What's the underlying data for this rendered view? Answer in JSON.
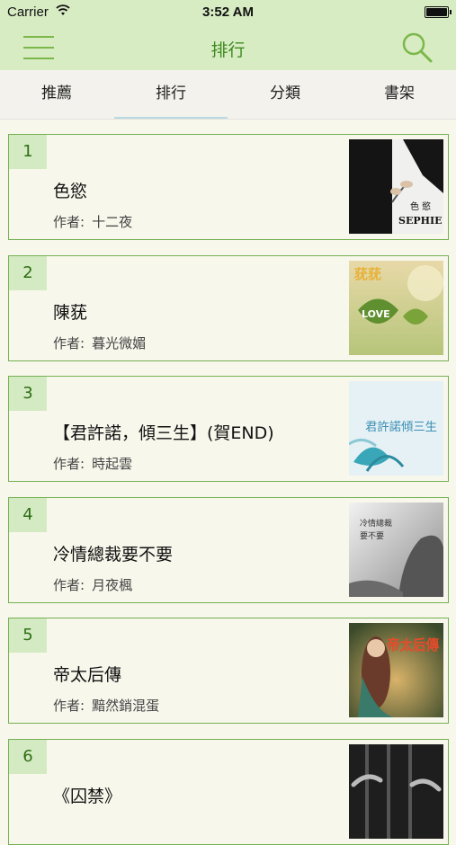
{
  "status_bar": {
    "carrier": "Carrier",
    "time": "3:52 AM"
  },
  "nav": {
    "title": "排行"
  },
  "tabs": [
    {
      "label": "推薦"
    },
    {
      "label": "排行"
    },
    {
      "label": "分類"
    },
    {
      "label": "書架"
    }
  ],
  "author_label": "作者:",
  "books": [
    {
      "rank": "1",
      "title": "色慾",
      "author": "十二夜",
      "cover_text": "色  慾",
      "cover_subtext": "SEPHIE"
    },
    {
      "rank": "2",
      "title": "陳莸",
      "author": "暮光微媚",
      "cover_text": "莸莸",
      "cover_subtext": "LOVE"
    },
    {
      "rank": "3",
      "title": "【君許諾，傾三生】(賀END)",
      "author": "時起雲",
      "cover_text": "君許諾傾三生"
    },
    {
      "rank": "4",
      "title": "冷情總裁要不要",
      "author": "月夜楓",
      "cover_text": "冷情總裁",
      "cover_subtext": "要不要"
    },
    {
      "rank": "5",
      "title": "帝太后傳",
      "author": "黯然銷混蛋",
      "cover_text": "帝太后傳"
    },
    {
      "rank": "6",
      "title": "《囚禁》",
      "author": ""
    }
  ],
  "colors": {
    "accent": "#3f8a1e",
    "header_bg": "#d8ecc4",
    "card_border": "#74b052",
    "rank_bg": "#d4eac2"
  }
}
